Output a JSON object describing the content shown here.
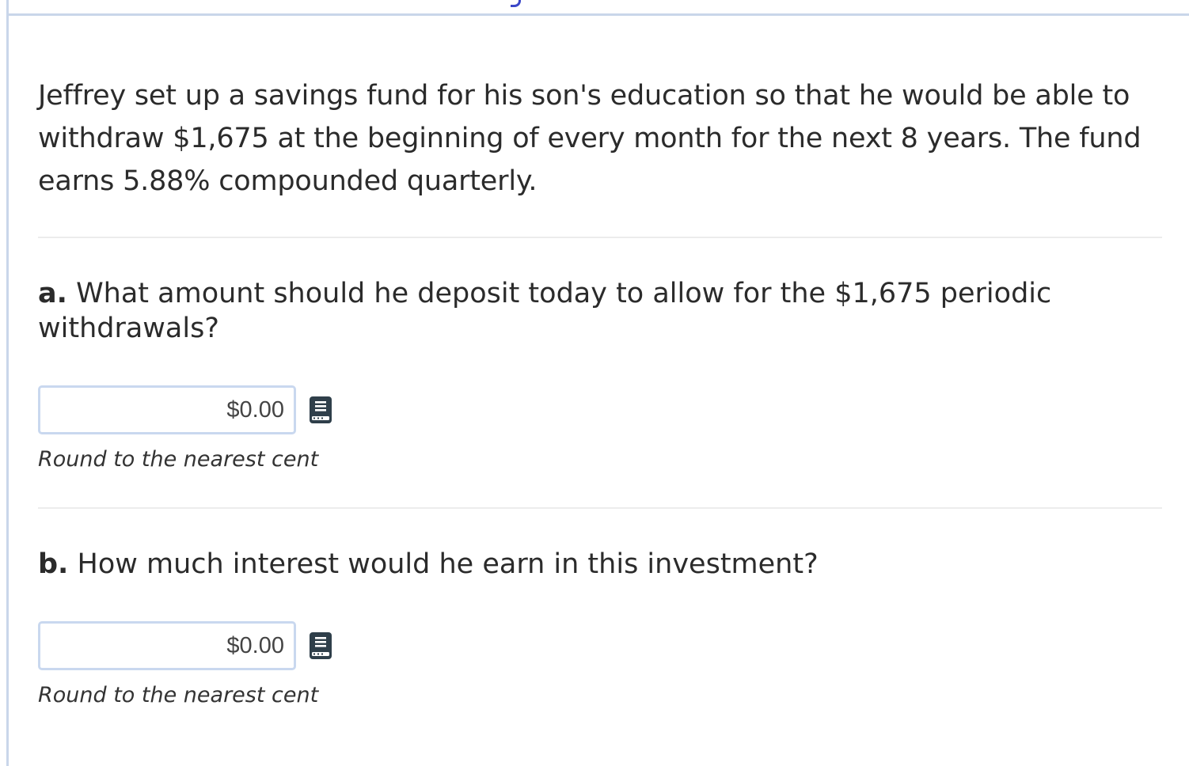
{
  "problem": {
    "text": "Jeffrey set up a savings fund for his son's education so that he would be able to withdraw $1,675 at the beginning of every month for the next 8 years. The fund earns 5.88% compounded quarterly."
  },
  "parts": [
    {
      "letter": "a.",
      "question": "What amount should he deposit today to allow for the $1,675 periodic withdrawals?",
      "input_value": "",
      "input_placeholder": "$0.00",
      "hint": "Round to the nearest cent",
      "icon": "book-icon"
    },
    {
      "letter": "b.",
      "question": "How much interest would he earn in this investment?",
      "input_value": "",
      "input_placeholder": "$0.00",
      "hint": "Round to the nearest cent",
      "icon": "book-icon"
    }
  ],
  "colors": {
    "border": "#c9d6ea",
    "accent": "#3b47c8",
    "icon": "#2f3f4a"
  }
}
